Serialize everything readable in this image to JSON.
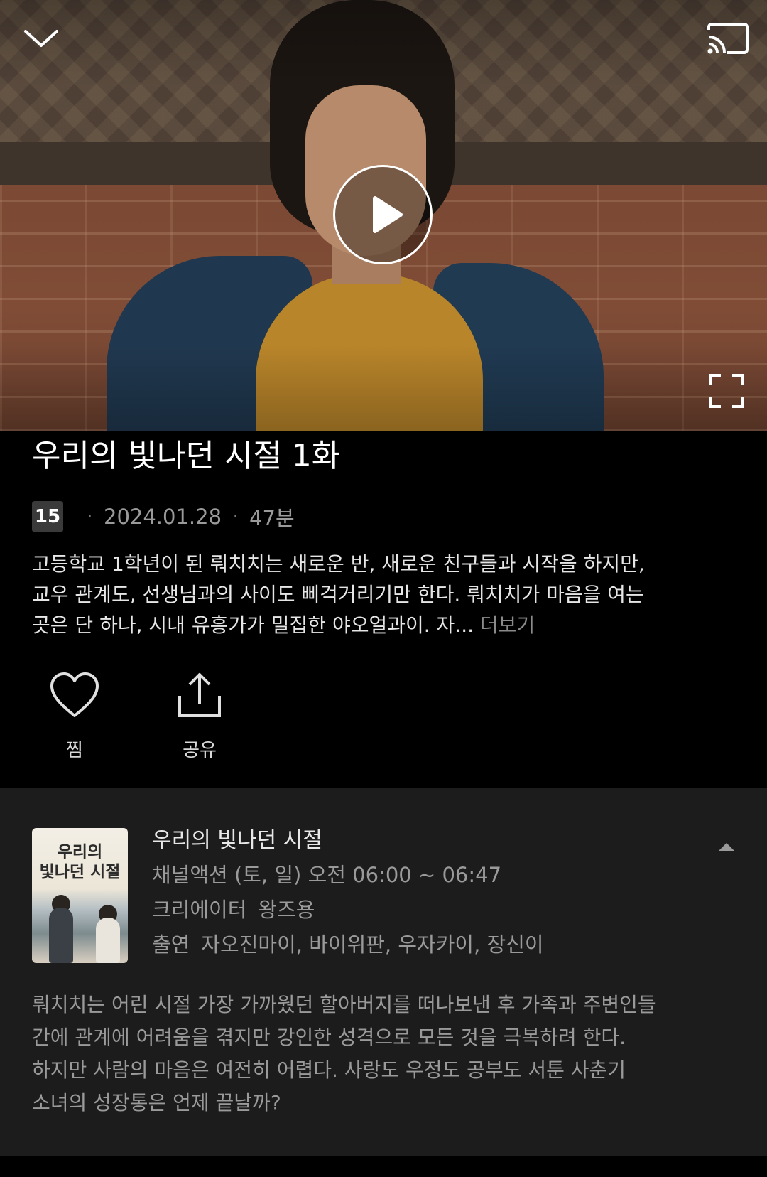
{
  "player": {
    "icons": {
      "collapse": "chevron-down-icon",
      "cast": "cast-icon",
      "play": "play-icon",
      "fullscreen": "fullscreen-icon"
    }
  },
  "episode": {
    "title": "우리의 빛나던 시절 1화",
    "age_rating": "15",
    "date": "2024.01.28",
    "duration": "47분",
    "synopsis_lines": [
      "고등학교 1학년이 된 뤄치치는 새로운 반, 새로운 친구들과 시작을 하지만,",
      "교우 관계도, 선생님과의 사이도 삐걱거리기만 한다. 뤄치치가 마음을 여는",
      "곳은 단 하나, 시내 유흥가가 밀집한 야오얼과이. 자..."
    ],
    "more_label": "더보기"
  },
  "actions": {
    "like_label": "찜",
    "share_label": "공유"
  },
  "program": {
    "poster_title_line1": "우리의",
    "poster_title_line2": "빛나던 시절",
    "title": "우리의 빛나던 시절",
    "schedule": "채널액션 (토, 일) 오전 06:00 ~ 06:47",
    "creator_label": "크리에이터",
    "creator_value": "왕즈용",
    "cast_label": "출연",
    "cast_value": "자오진마이, 바이위판, 우자카이, 장신이",
    "description_lines": [
      "뤄치치는 어린 시절 가장 가까웠던 할아버지를 떠나보낸 후 가족과 주변인들",
      "간에 관계에 어려움을 겪지만 강인한 성격으로 모든 것을 극복하려 한다.",
      "하지만 사람의 마음은 여전히 어렵다. 사랑도 우정도 공부도 서툰 사춘기",
      "소녀의 성장통은 언제 끝날까?"
    ]
  }
}
